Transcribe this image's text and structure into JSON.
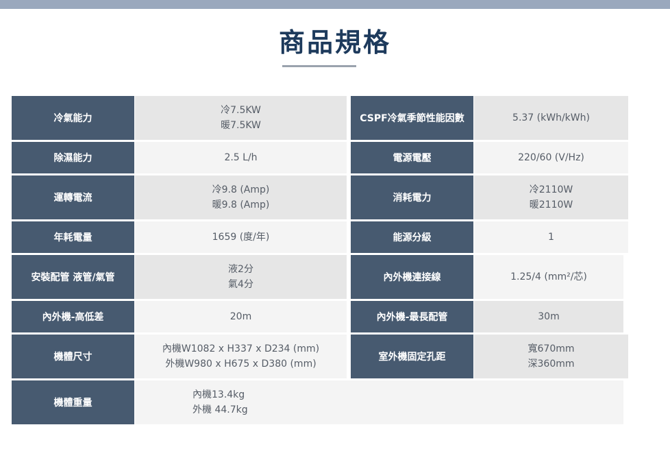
{
  "page": {
    "title": "商品規格"
  },
  "specs": {
    "r1": {
      "l_label": "冷氣能力",
      "l_value": [
        "冷7.5KW",
        "暖7.5KW"
      ],
      "r_label": "CSPF冷氣季節性能因數",
      "r_value": [
        "5.37 (kWh/kWh)"
      ]
    },
    "r2": {
      "l_label": "除濕能力",
      "l_value": [
        "2.5 L/h"
      ],
      "r_label": "電源電壓",
      "r_value": [
        "220/60 (V/Hz)"
      ]
    },
    "r3": {
      "l_label": "運轉電流",
      "l_value": [
        "冷9.8 (Amp)",
        "暖9.8 (Amp)"
      ],
      "r_label": "消耗電力",
      "r_value": [
        "冷2110W",
        "暖2110W"
      ]
    },
    "r4": {
      "l_label": "年耗電量",
      "l_value": [
        "1659 (度/年)"
      ],
      "r_label": "能源分級",
      "r_value": [
        "1"
      ]
    },
    "r5": {
      "l_label": "安裝配管 液管/氣管",
      "l_value": [
        "液2分",
        "氣4分"
      ],
      "r_label": "內外機連接線",
      "r_value": [
        "1.25/4 (mm²/芯)"
      ]
    },
    "r6": {
      "l_label": "內外機-高低差",
      "l_value": [
        "20m"
      ],
      "r_label": "內外機-最長配管",
      "r_value": [
        "30m"
      ]
    },
    "r7": {
      "l_label": "機體尺寸",
      "l_value": [
        "內機W1082 x H337 x D234 (mm)",
        "外機W980 x H675 x D380 (mm)"
      ],
      "r_label": "室外機固定孔距",
      "r_value": [
        "寬670mm",
        "深360mm"
      ]
    },
    "r8": {
      "l_label": "機體重量",
      "l_value": [
        "內機13.4kg",
        "外機 44.7kg"
      ]
    }
  }
}
